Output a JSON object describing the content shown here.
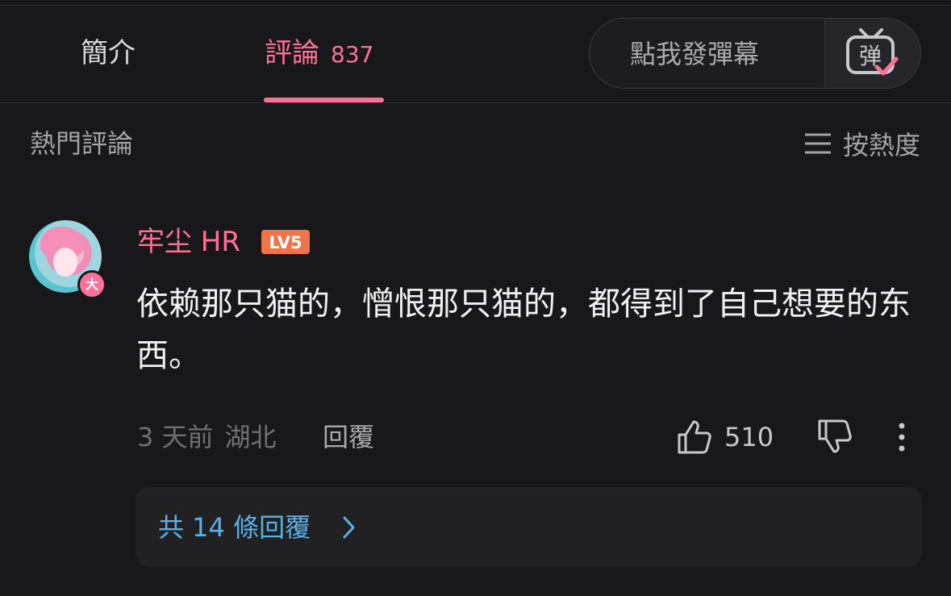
{
  "tabs": {
    "intro_label": "簡介",
    "comments_label": "評論",
    "comments_count": "837"
  },
  "danmaku": {
    "placeholder": "點我發彈幕",
    "button_icon": "danmaku-tv-icon",
    "button_glyph": "弹"
  },
  "section": {
    "title": "熱門評論",
    "sort_label": "按熱度",
    "sort_icon": "menu-lines-icon"
  },
  "comment": {
    "username": "牢尘 HR",
    "level": "LV5",
    "vip_badge": "大",
    "text": "依赖那只猫的，憎恨那只猫的，都得到了自己想要的东西。",
    "time": "3 天前",
    "location": "湖北",
    "reply_label": "回覆",
    "like_count": "510",
    "like_icon": "thumbs-up-icon",
    "dislike_icon": "thumbs-down-icon",
    "more_icon": "more-vertical-icon"
  },
  "replies": {
    "label": "共 14 條回覆",
    "chevron_icon": "chevron-right-icon"
  },
  "colors": {
    "accent": "#fb7299",
    "link_blue": "#5ab0e8",
    "level_orange": "#f0734a"
  }
}
